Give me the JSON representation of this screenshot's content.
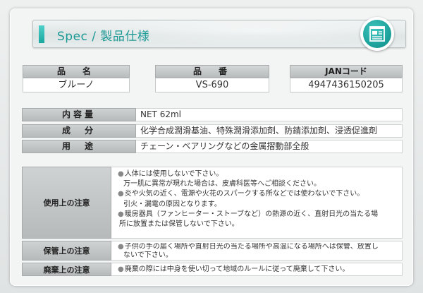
{
  "header": {
    "title": "Spec / 製品仕様",
    "icon": "document-icon",
    "accent_color": "#1ea8a0"
  },
  "top_specs": [
    {
      "label": "品　名",
      "value": "ブルーノ"
    },
    {
      "label": "品　番",
      "value": "VS-690"
    },
    {
      "label": "JANコード",
      "value": "4947436150205"
    }
  ],
  "specs": [
    {
      "label": "内容量",
      "value": "NET 62ml"
    },
    {
      "label": "成　分",
      "value": "化学合成潤滑基油、特殊潤滑添加剤、防錆添加剤、浸透促進剤"
    },
    {
      "label": "用　途",
      "value": "チェーン・ベアリングなどの金属摺動部全般"
    }
  ],
  "notes": [
    {
      "label": "使用上の注意",
      "lines": [
        "人体には使用しないで下さい。",
        "万一肌に異常が現れた場合は、皮膚科医等へご相談ください。",
        "炎や火気の近く、電源や火花のスパークする所などでは使わないで下さい。",
        "引火・漏電の原因となります。",
        "暖房器具（ファンヒーター・ストーブなど）の熱源の近く、直射日光の当たる場",
        "所に放置または保管しないで下さい。"
      ]
    },
    {
      "label": "保管上の注意",
      "lines": [
        "子供の手の届く場所や直射日光の当たる場所や高温になる場所へは保管、放置し",
        "ないで下さい。"
      ]
    },
    {
      "label": "廃棄上の注意",
      "lines": [
        "廃棄の際には中身を使い切って地域のルールに従って廃棄して下さい。"
      ]
    }
  ]
}
